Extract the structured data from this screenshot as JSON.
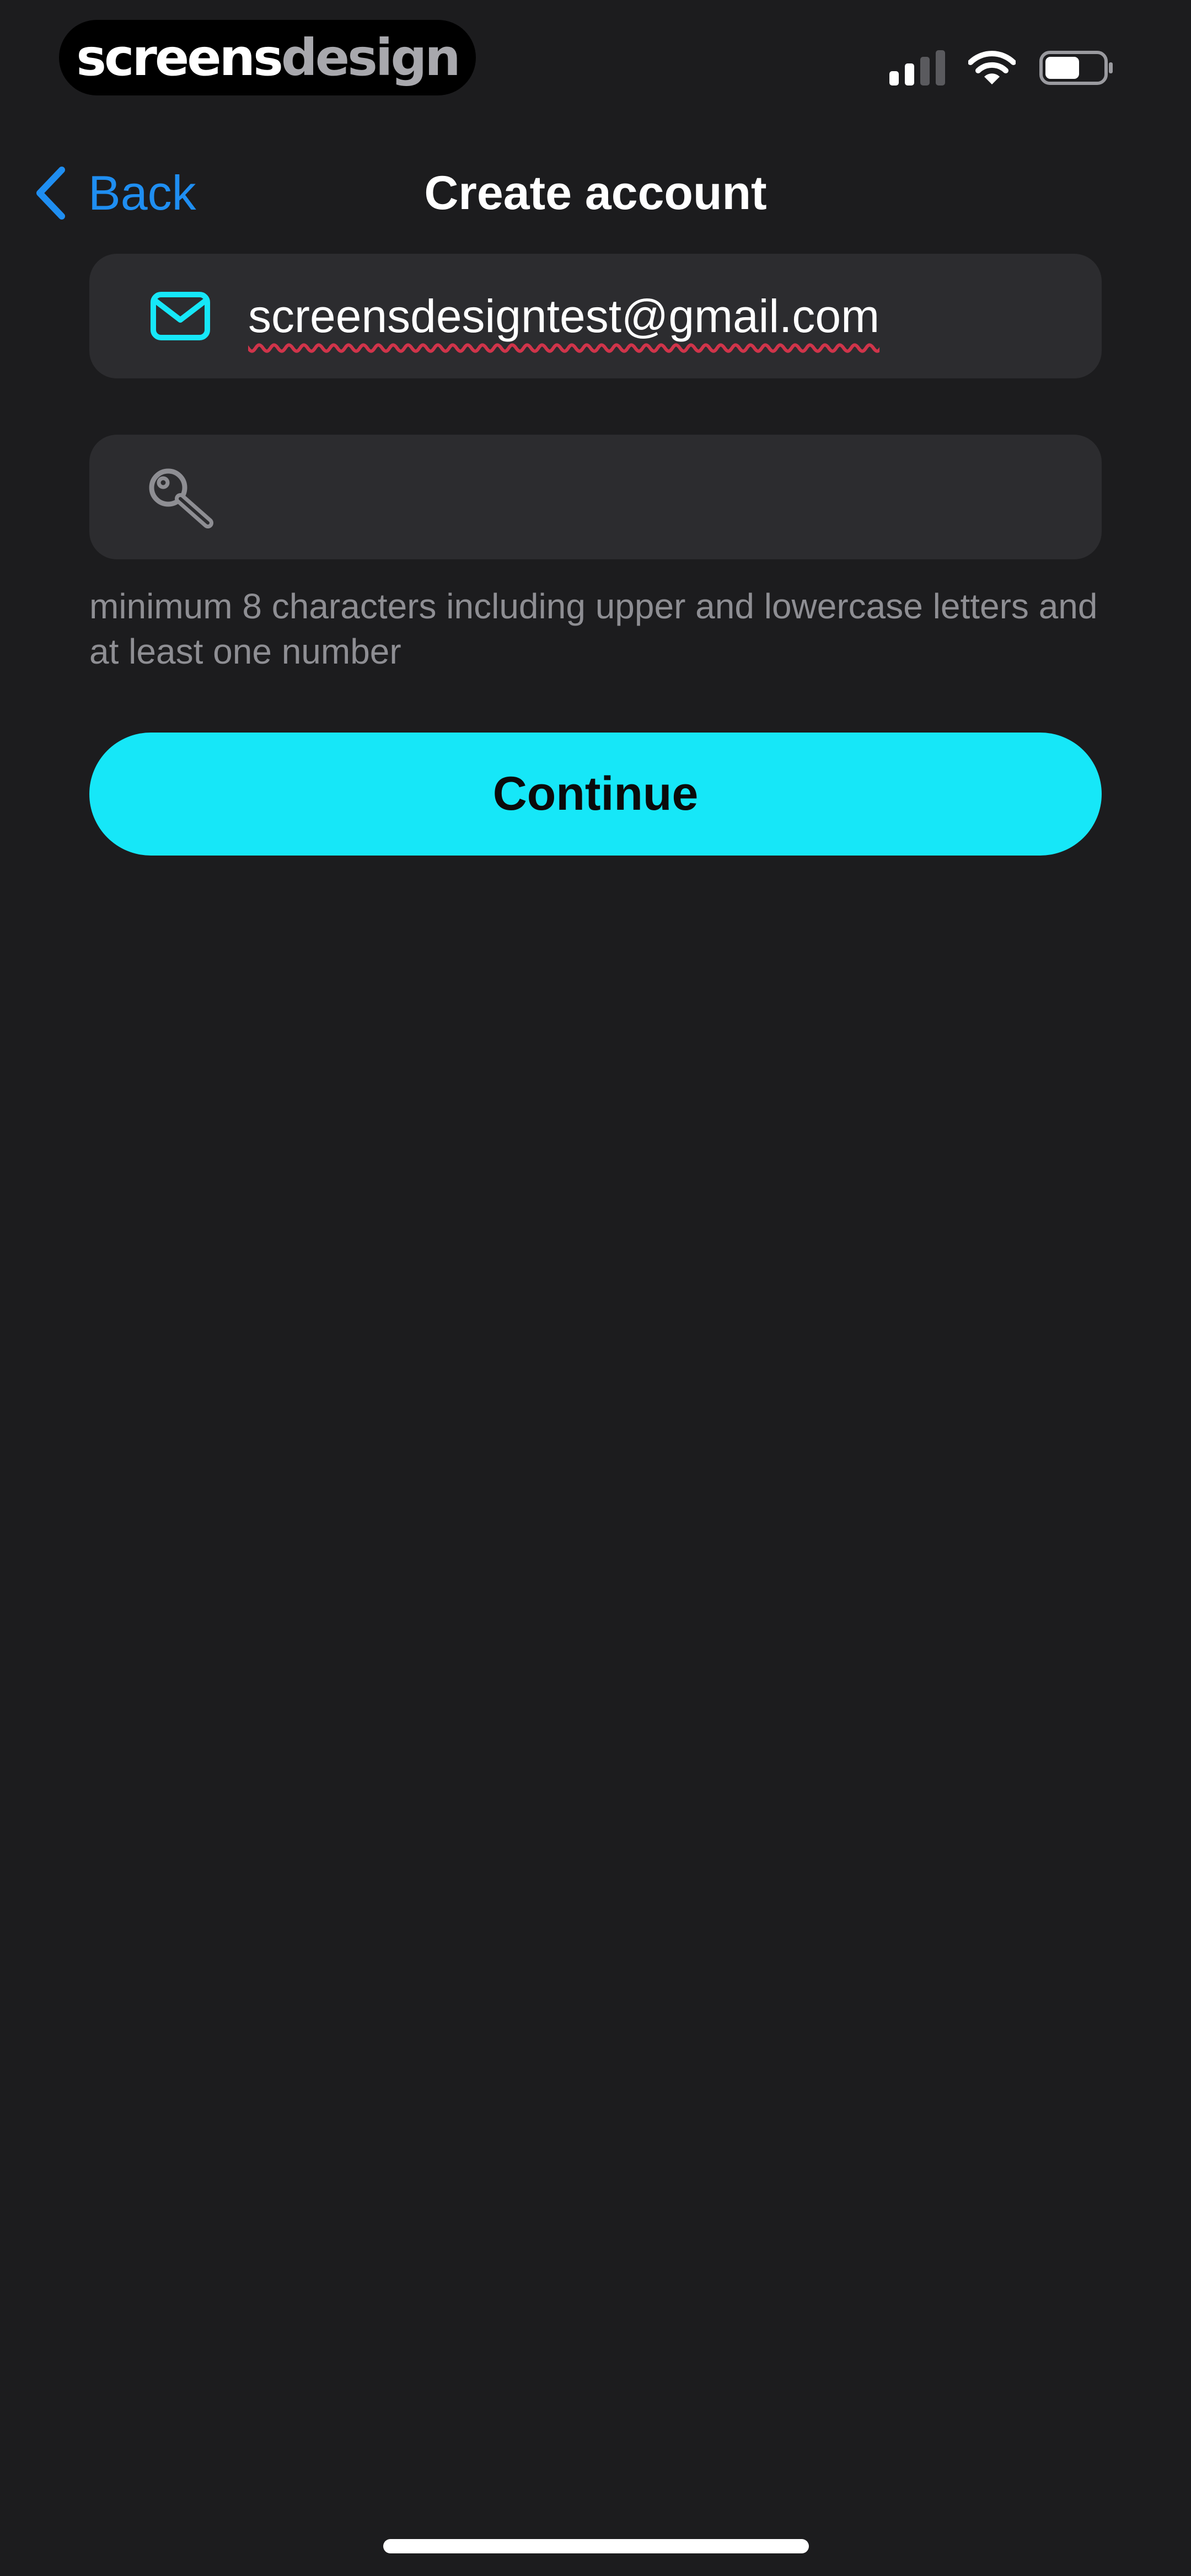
{
  "status_bar": {
    "brand": {
      "part1": "screens",
      "part2": "design"
    },
    "icons": [
      "signal-icon",
      "wifi-icon",
      "battery-icon"
    ],
    "battery_level": 0.6
  },
  "nav": {
    "back_label": "Back",
    "back_icon": "chevron-left-icon",
    "title": "Create account"
  },
  "form": {
    "email": {
      "icon": "mail-icon",
      "value": "screensdesigntest@gmail.com"
    },
    "password": {
      "icon": "key-icon",
      "value": "",
      "placeholder": ""
    },
    "hint": "minimum 8 characters including upper and lowercase letters and at least one number",
    "continue_label": "Continue"
  },
  "colors": {
    "background": "#1c1c1e",
    "field_background": "#2c2c2f",
    "accent": "#16e7f8",
    "link": "#1f8ef1",
    "hint_text": "#8e8e93",
    "spellcheck": "#d0344a"
  }
}
